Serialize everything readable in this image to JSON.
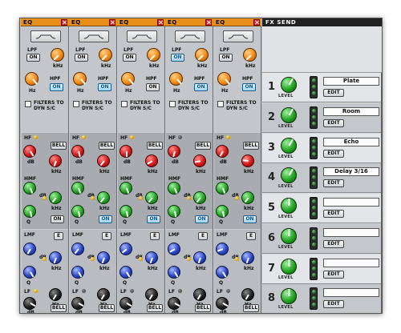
{
  "strips": [
    {
      "title": "EQ"
    },
    {
      "title": "EQ"
    },
    {
      "title": "EQ"
    },
    {
      "title": "EQ"
    },
    {
      "title": "EQ"
    }
  ],
  "labels": {
    "lpf": "LPF",
    "hpf": "HPF",
    "on": "ON",
    "khz": "kHz",
    "hz": "Hz",
    "db": "dB",
    "filters_to": "FILTERS TO",
    "dyn_sc": "DYN S/C",
    "hf": "HF",
    "hmf": "HMF",
    "lmf": "LMF",
    "lf": "LF",
    "bell": "BELL",
    "e": "E",
    "q": "Q"
  },
  "fx": {
    "title": "FX SEND",
    "level_label": "LEVEL",
    "edit_label": "EDIT",
    "sends": [
      {
        "num": "1",
        "name": "Plate"
      },
      {
        "num": "2",
        "name": "Room"
      },
      {
        "num": "3",
        "name": "Echo"
      },
      {
        "num": "4",
        "name": "Delay 3/16"
      },
      {
        "num": "5",
        "name": ""
      },
      {
        "num": "6",
        "name": ""
      },
      {
        "num": "7",
        "name": ""
      },
      {
        "num": "8",
        "name": ""
      }
    ]
  },
  "colors": {
    "header_orange": "#e88f1a",
    "on_blue": "#0b5aa0",
    "scroll_blue": "#2a6ad0"
  }
}
